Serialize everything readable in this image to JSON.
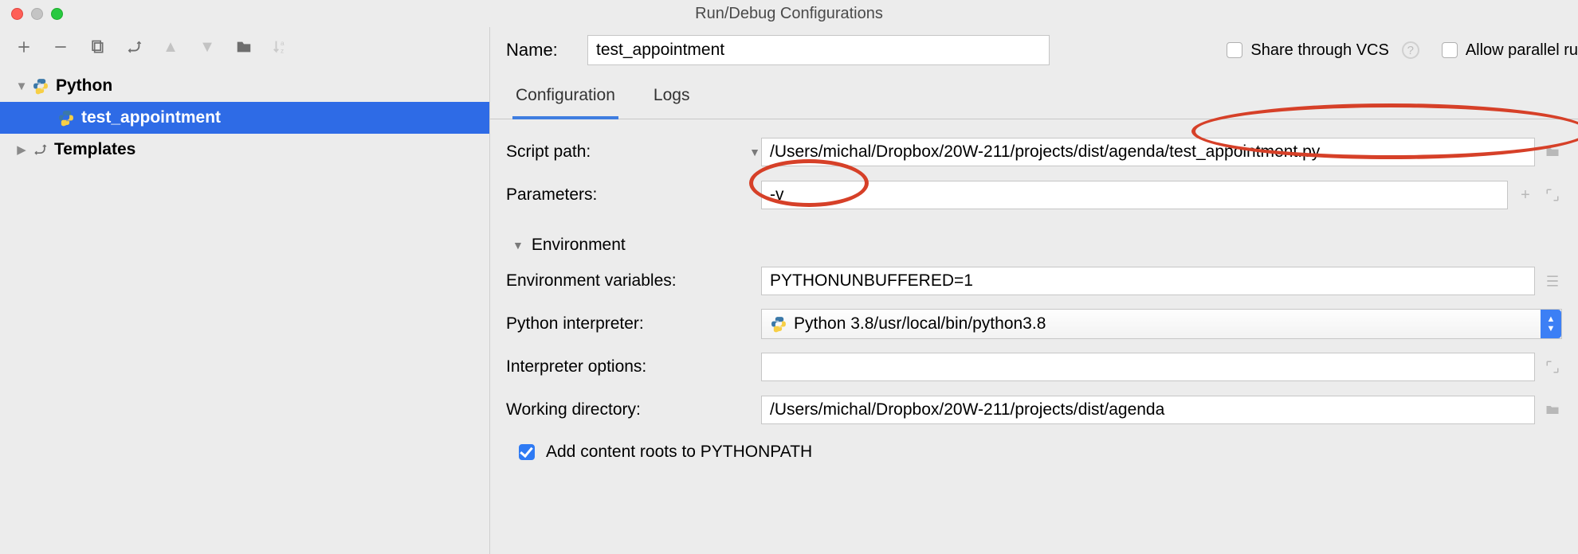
{
  "window": {
    "title": "Run/Debug Configurations"
  },
  "tree": {
    "root_python": "Python",
    "item_test_appointment": "test_appointment",
    "root_templates": "Templates"
  },
  "name": {
    "label": "Name:",
    "value": "test_appointment",
    "share_label": "Share through VCS",
    "allow_label": "Allow parallel ru"
  },
  "tabs": {
    "configuration": "Configuration",
    "logs": "Logs"
  },
  "form": {
    "script_path_label": "Script path:",
    "script_path_value": "/Users/michal/Dropbox/20W-211/projects/dist/agenda/test_appointment.py",
    "parameters_label": "Parameters:",
    "parameters_value": "-v",
    "environment_header": "Environment",
    "env_vars_label": "Environment variables:",
    "env_vars_value": "PYTHONUNBUFFERED=1",
    "interpreter_label": "Python interpreter:",
    "interpreter_value": "Python 3.8",
    "interpreter_path": "/usr/local/bin/python3.8",
    "interp_options_label": "Interpreter options:",
    "interp_options_value": "",
    "working_dir_label": "Working directory:",
    "working_dir_value": "/Users/michal/Dropbox/20W-211/projects/dist/agenda",
    "add_content_roots_label": "Add content roots to PYTHONPATH"
  }
}
